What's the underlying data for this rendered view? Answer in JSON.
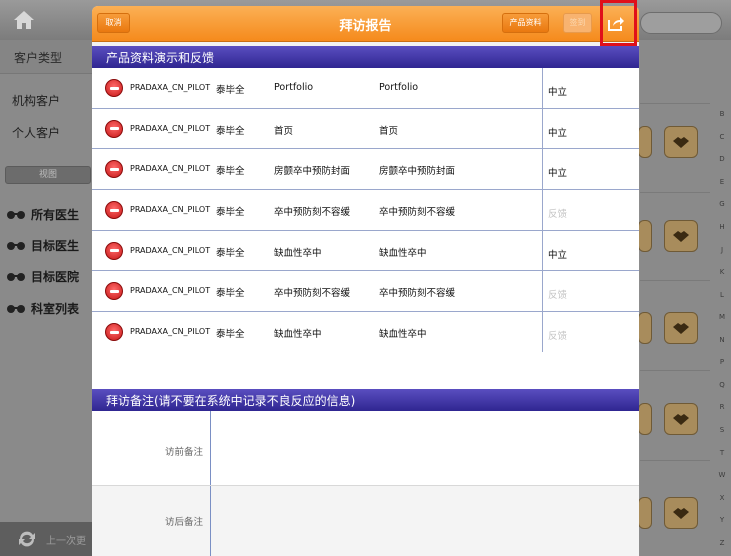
{
  "background": {
    "sidebar": {
      "header": "客户类型",
      "items": [
        "机构客户",
        "个人客户"
      ],
      "view_button": "视图",
      "filters": [
        "所有医生",
        "目标医生",
        "目标医院",
        "科室列表"
      ],
      "bottom_status": "上一次更"
    },
    "alphabet": [
      "B",
      "C",
      "D",
      "E",
      "G",
      "H",
      "J",
      "K",
      "L",
      "M",
      "N",
      "P",
      "Q",
      "R",
      "S",
      "T",
      "W",
      "X",
      "Y",
      "Z"
    ]
  },
  "modal": {
    "title": "拜访报告",
    "cancel_label": "取消",
    "materials_label": "产品资料",
    "signin_label": "签到",
    "section1_title": "产品资料演示和反馈",
    "section2_title": "拜访备注(请不要在系统中记录不良反应的信息)",
    "rows": [
      {
        "code": "PRADAXA_CN_PILOT",
        "person": "泰毕全",
        "product": "Portfolio",
        "name": "Portfolio",
        "feedback": "中立"
      },
      {
        "code": "PRADAXA_CN_PILOT",
        "person": "泰毕全",
        "product": "首页",
        "name": "首页",
        "feedback": "中立"
      },
      {
        "code": "PRADAXA_CN_PILOT",
        "person": "泰毕全",
        "product": "房颤卒中预防封面",
        "name": "房颤卒中预防封面",
        "feedback": "中立"
      },
      {
        "code": "PRADAXA_CN_PILOT",
        "person": "泰毕全",
        "product": "卒中预防刻不容缓",
        "name": "卒中预防刻不容缓",
        "feedback": "反馈"
      },
      {
        "code": "PRADAXA_CN_PILOT",
        "person": "泰毕全",
        "product": "缺血性卒中",
        "name": "缺血性卒中",
        "feedback": "中立"
      },
      {
        "code": "PRADAXA_CN_PILOT",
        "person": "泰毕全",
        "product": "卒中预防刻不容缓",
        "name": "卒中预防刻不容缓",
        "feedback": "反馈"
      },
      {
        "code": "PRADAXA_CN_PILOT",
        "person": "泰毕全",
        "product": "缺血性卒中",
        "name": "缺血性卒中",
        "feedback": "反馈"
      }
    ],
    "notes": {
      "pre_label": "访前备注",
      "post_label": "访后备注"
    }
  },
  "colors": {
    "header_orange": "#f58a1c",
    "section_purple": "#2f2691",
    "highlight_red": "#e0101a",
    "minus_red": "#c61616"
  }
}
